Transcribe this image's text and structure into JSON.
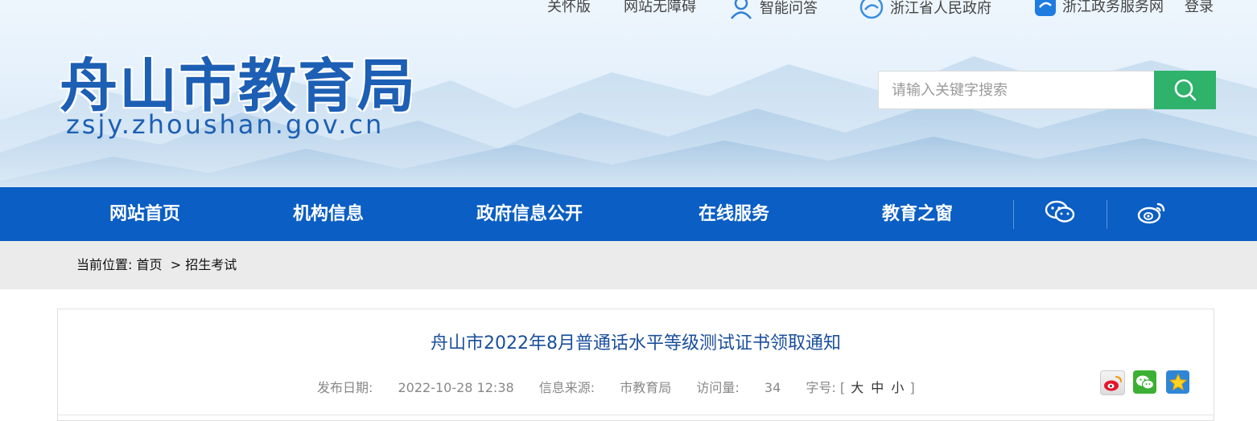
{
  "topbar": {
    "care_label": "关怀版",
    "accessible_label": "网站无障碍",
    "qa_label": "智能问答",
    "gov_label": "浙江省人民政府",
    "service_label": "浙江政务服务网",
    "login_label": "登录"
  },
  "header": {
    "title": "舟山市教育局",
    "url": "zsjy.zhoushan.gov.cn"
  },
  "search": {
    "placeholder": "请输入关键字搜索",
    "icon": "search-icon"
  },
  "nav": {
    "items": [
      "网站首页",
      "机构信息",
      "政府信息公开",
      "在线服务",
      "教育之窗"
    ],
    "social_icons": [
      "wechat-icon",
      "weibo-icon"
    ]
  },
  "breadcrumb": {
    "prefix": "当前位置:",
    "home": "首页",
    "sep": ">",
    "current": "招生考试"
  },
  "article": {
    "title": "舟山市2022年8月普通话水平等级测试证书领取通知",
    "date_label": "发布日期:",
    "date": "2022-10-28 12:38",
    "source_label": "信息来源:",
    "source": "市教育局",
    "visits_label": "访问量:",
    "visits": "34",
    "fontsize_label": "字号:",
    "fontsize_open": "[",
    "fontsize_large": "大",
    "fontsize_medium": "中",
    "fontsize_small": "小",
    "fontsize_close": "]",
    "share_icons": [
      "weibo-icon",
      "wechat-icon",
      "favorite-star-icon"
    ]
  },
  "colors": {
    "brand_blue": "#0a5ec4",
    "title_blue": "#1a4f9c",
    "search_green": "#2fb26a",
    "breadcrumb_bg": "#ebebeb"
  }
}
